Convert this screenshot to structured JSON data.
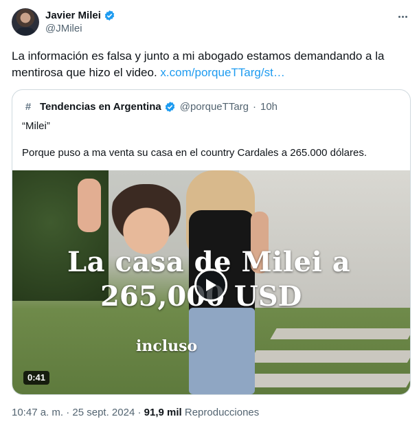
{
  "author": {
    "name": "Javier Milei",
    "handle": "@JMilei"
  },
  "tweet": {
    "text": "La información es falsa y junto a mi abogado estamos demandando a la mentirosa que hizo el video.",
    "link": "x.com/porqueTTarg/st…"
  },
  "quote": {
    "hash": "#",
    "name": "Tendencias en Argentina",
    "handle": "@porqueTTarg",
    "separator": "·",
    "time": "10h",
    "line1": "“Milei”",
    "line2": "Porque puso a ma venta su casa en el country Cardales a 265.000 dólares.",
    "video": {
      "caption_line1": "La casa de Milei a",
      "caption_line2": "265,000 USD",
      "caption_sub": "incluso",
      "duration": "0:41"
    }
  },
  "meta": {
    "time": "10:47 a. m.",
    "sep1": "·",
    "date": "25 sept. 2024",
    "sep2": "·",
    "views": "91,9 mil",
    "views_label": "Reproducciones"
  },
  "colors": {
    "accent": "#1d9bf0",
    "secondary_text": "#536471",
    "border": "#cfd9de"
  },
  "icons": {
    "verified": "verified-badge-icon",
    "more": "more-options-icon",
    "play": "play-icon"
  }
}
